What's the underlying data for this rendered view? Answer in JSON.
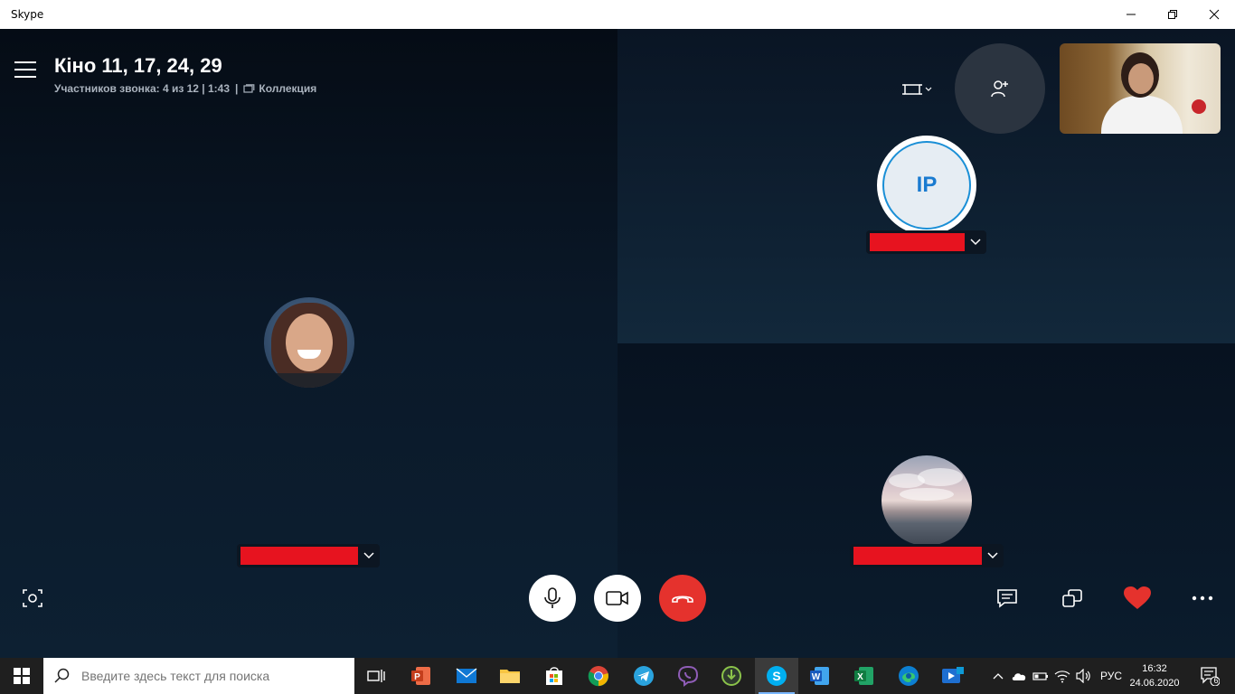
{
  "window": {
    "title": "Skype"
  },
  "call": {
    "title": "Кіно 11, 17, 24, 29",
    "participants": "Участников звонка: 4 из 12 | 1:43",
    "separator": "|",
    "collection": "Коллекция"
  },
  "participants": [
    {
      "initials": "IP",
      "ring_color": "#1a8fd6"
    }
  ],
  "taskbar": {
    "search_placeholder": "Введите здесь текст для поиска",
    "language": "РУС",
    "time": "16:32",
    "date": "24.06.2020",
    "notification_count": "6"
  },
  "colors": {
    "hangup": "#e5322d",
    "heart": "#e5322d",
    "redaction": "#e7131f",
    "accent": "#1a8fd6"
  }
}
